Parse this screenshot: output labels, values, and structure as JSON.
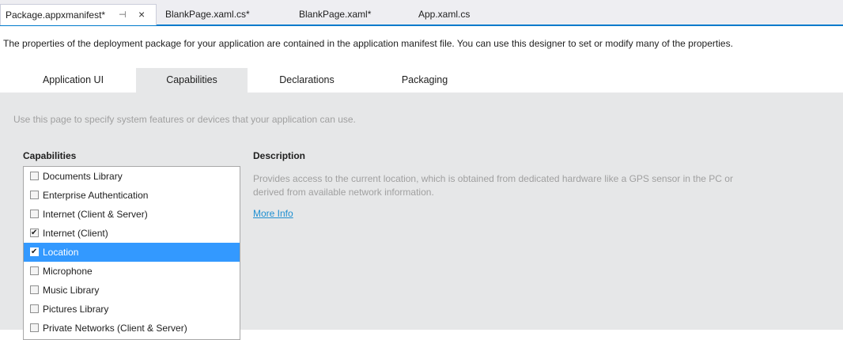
{
  "doc_tabs": {
    "active_label": "Package.appxmanifest*",
    "pin_glyph": "⊣",
    "close_glyph": "×",
    "others": [
      "BlankPage.xaml.cs*",
      "BlankPage.xaml*",
      "App.xaml.cs"
    ]
  },
  "intro": "The properties of the deployment package for your application are contained in the application manifest file. You can use this designer to set or modify many of the properties.",
  "designer_tabs": [
    "Application UI",
    "Capabilities",
    "Declarations",
    "Packaging"
  ],
  "selected_designer_tab": "Capabilities",
  "hint": "Use this page to specify system features or devices that your application can use.",
  "capabilities": {
    "heading": "Capabilities",
    "items": [
      {
        "label": "Documents Library",
        "checked": false,
        "selected": false
      },
      {
        "label": "Enterprise Authentication",
        "checked": false,
        "selected": false
      },
      {
        "label": "Internet (Client & Server)",
        "checked": false,
        "selected": false
      },
      {
        "label": "Internet (Client)",
        "checked": true,
        "selected": false
      },
      {
        "label": "Location",
        "checked": true,
        "selected": true
      },
      {
        "label": "Microphone",
        "checked": false,
        "selected": false
      },
      {
        "label": "Music Library",
        "checked": false,
        "selected": false
      },
      {
        "label": "Pictures Library",
        "checked": false,
        "selected": false
      },
      {
        "label": "Private Networks (Client & Server)",
        "checked": false,
        "selected": false
      }
    ]
  },
  "description": {
    "heading": "Description",
    "text": "Provides access to the current location, which is obtained from dedicated hardware like a GPS sensor in the PC or derived from available network information.",
    "link": "More Info"
  },
  "colors": {
    "accent": "#007acc",
    "selection": "#3399ff",
    "link": "#1e8fd1",
    "panel_bg": "#e6e7e8"
  }
}
